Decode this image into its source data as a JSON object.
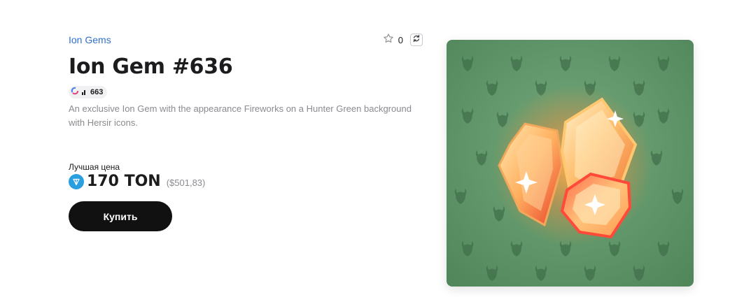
{
  "collection": {
    "name": "Ion Gems"
  },
  "favorites": {
    "count": "0",
    "icon": "star-outline-icon"
  },
  "refresh": {
    "icon": "refresh-icon"
  },
  "item": {
    "title": "Ion Gem #636",
    "rating": "663",
    "description": "An exclusive Ion Gem with the appearance Fireworks on a Hunter Green background with Hersir icons."
  },
  "price": {
    "label": "Лучшая цена",
    "ton": "170 TON",
    "usd": "($501,83)",
    "currency_icon": "ton-icon"
  },
  "buy": {
    "label": "Купить"
  },
  "colors": {
    "link": "#2f6fd0",
    "button_bg": "#111111",
    "card_bg": "#63996c",
    "ton": "#2a9fe0"
  }
}
